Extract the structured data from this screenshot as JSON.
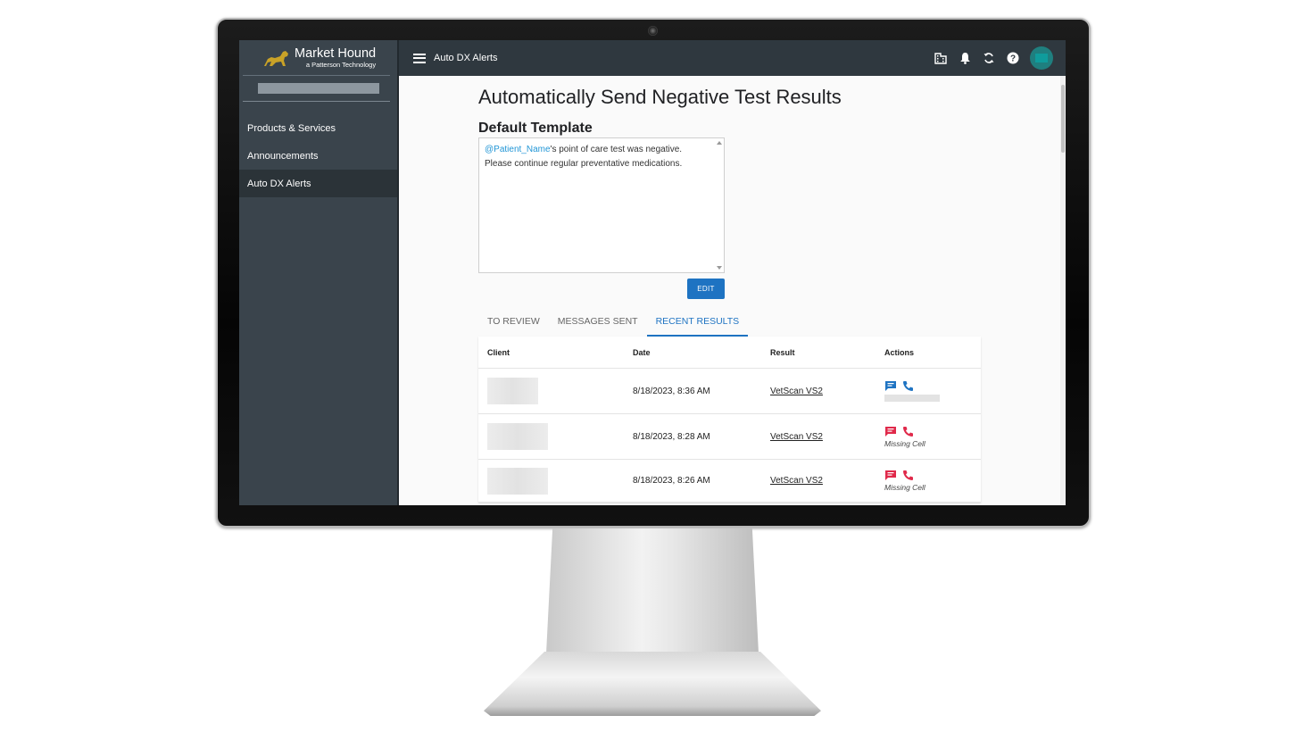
{
  "brand": {
    "name": "Market Hound",
    "subtitle": "a Patterson Technology"
  },
  "sidebar": {
    "items": [
      {
        "label": "Products & Services",
        "active": false
      },
      {
        "label": "Announcements",
        "active": false
      },
      {
        "label": "Auto DX Alerts",
        "active": true
      }
    ]
  },
  "topbar": {
    "title": "Auto DX Alerts"
  },
  "page": {
    "title": "Automatically Send Negative Test Results",
    "template_heading": "Default Template",
    "template": {
      "mention": "@Patient_Name",
      "text_after_mention": "'s point of care test was negative.",
      "line2": "Please continue regular preventative medications."
    },
    "edit_label": "EDIT"
  },
  "tabs": [
    {
      "label": "TO REVIEW",
      "active": false
    },
    {
      "label": "MESSAGES SENT",
      "active": false
    },
    {
      "label": "RECENT RESULTS",
      "active": true
    }
  ],
  "table": {
    "headers": {
      "client": "Client",
      "date": "Date",
      "result": "Result",
      "actions": "Actions"
    },
    "rows": [
      {
        "date": "8/18/2023, 8:36 AM",
        "result": "VetScan VS2",
        "status": "ok",
        "note": ""
      },
      {
        "date": "8/18/2023, 8:28 AM",
        "result": "VetScan VS2",
        "status": "missing",
        "note": "Missing Cell"
      },
      {
        "date": "8/18/2023, 8:26 AM",
        "result": "VetScan VS2",
        "status": "missing",
        "note": "Missing Cell"
      }
    ]
  },
  "colors": {
    "sidebar_bg": "#3a444c",
    "topbar_bg": "#2f383f",
    "accent_blue": "#1e73c2",
    "mention_blue": "#2296d6",
    "alert_red": "#e0294a",
    "brand_gold": "#c9a227"
  },
  "icons": [
    "menu-icon",
    "building-icon",
    "bell-icon",
    "sync-icon",
    "help-icon",
    "message-icon",
    "phone-icon"
  ]
}
